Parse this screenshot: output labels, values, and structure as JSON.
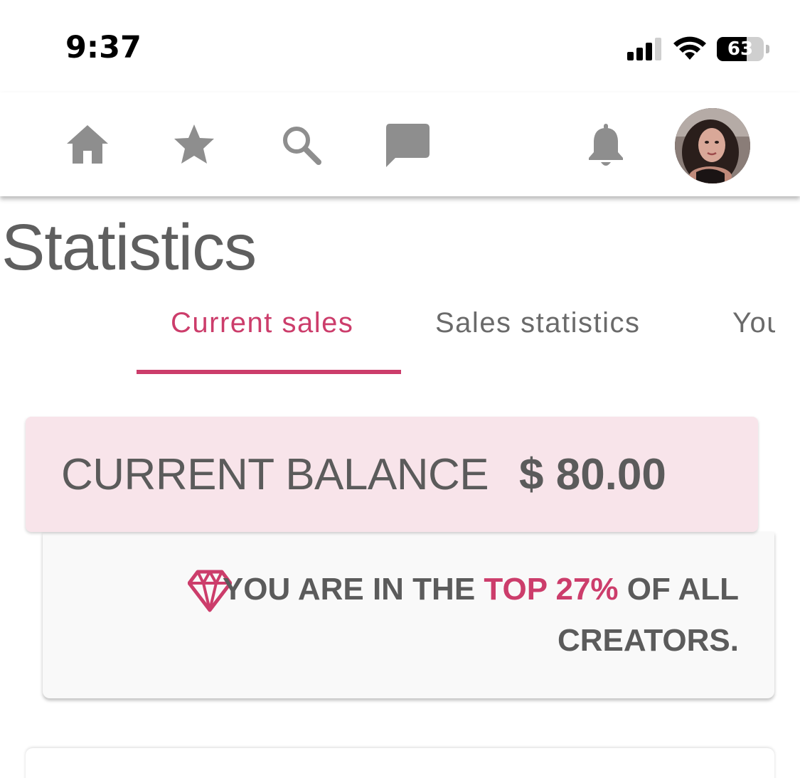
{
  "status_bar": {
    "time": "9:37",
    "battery_level": "63",
    "battery_fraction": 0.63,
    "icons": [
      "cellular-signal-icon",
      "wifi-icon",
      "battery-icon"
    ]
  },
  "nav": {
    "icons": [
      "home-icon",
      "star-icon",
      "search-icon",
      "chat-icon",
      "bell-icon",
      "avatar"
    ]
  },
  "page": {
    "title": "Statistics"
  },
  "tabs": [
    {
      "label": "Current sales",
      "active": true
    },
    {
      "label": "Sales statistics",
      "active": false
    },
    {
      "label": "You",
      "active": false
    }
  ],
  "balance": {
    "label": "CURRENT BALANCE",
    "amount": "$ 80.00"
  },
  "rank": {
    "prefix": "YOU ARE IN THE ",
    "highlight": "TOP 27%",
    "suffix": " OF ALL",
    "line2": "CREATORS.",
    "icon": "diamond-icon"
  },
  "colors": {
    "accent": "#cc3d6b",
    "text": "#5b5b5b",
    "balance_bg": "#f8e4ea",
    "icon_gray": "#8e8e8e"
  }
}
